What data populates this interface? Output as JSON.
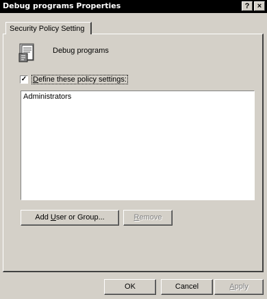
{
  "window": {
    "title": "Debug programs Properties",
    "help_label": "?",
    "close_label": "×"
  },
  "tabs": [
    {
      "label": "Security Policy Setting"
    }
  ],
  "policy": {
    "icon": "policy-book-icon",
    "name": "Debug programs"
  },
  "define_setting": {
    "checked": true,
    "check_glyph": "✓",
    "label_pre": "",
    "label_accel": "D",
    "label_post": "efine these policy settings:"
  },
  "members": {
    "items": [
      "Administrators"
    ]
  },
  "buttons": {
    "add_pre": "Add ",
    "add_accel": "U",
    "add_post": "ser or Group...",
    "remove_pre": "",
    "remove_accel": "R",
    "remove_post": "emove",
    "ok": "OK",
    "cancel": "Cancel",
    "apply_pre": "",
    "apply_accel": "A",
    "apply_post": "pply"
  },
  "colors": {
    "face": "#d4d0c8",
    "titlebar": "#000000",
    "disabled_text": "#808080"
  }
}
